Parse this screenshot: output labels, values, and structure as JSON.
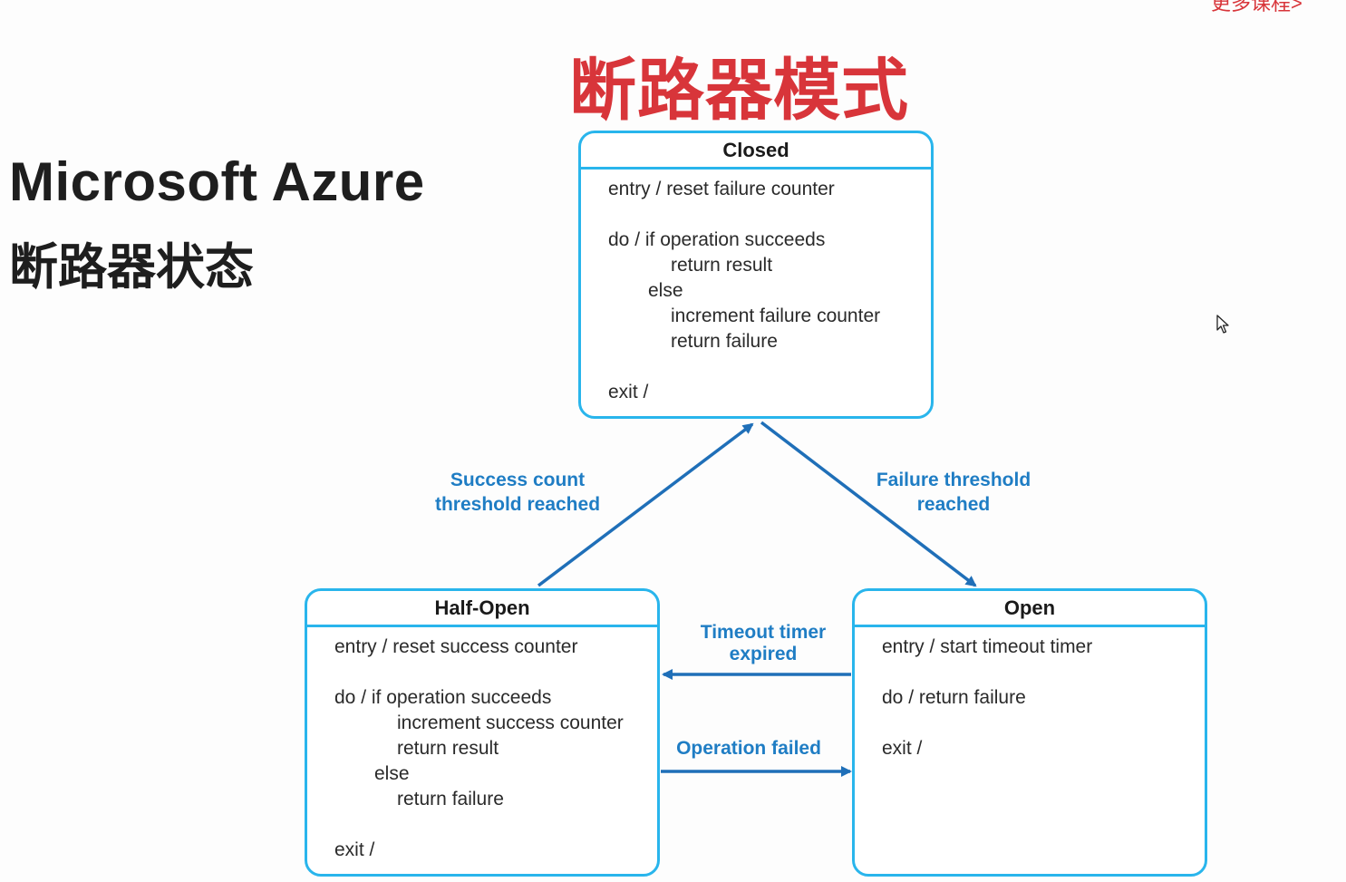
{
  "corner_text": "更多课程>",
  "main_title": "断路器模式",
  "left_title": {
    "line1": "Microsoft Azure",
    "line2": "断路器状态"
  },
  "colors": {
    "title_red": "#d8353a",
    "box_border": "#29b5ec",
    "arrow": "#1f6fb8",
    "label_blue": "#1f7dc4"
  },
  "states": {
    "closed": {
      "name": "Closed",
      "lines": [
        "entry / reset failure counter",
        "do / if operation succeeds",
        "return result",
        "else",
        "increment failure counter",
        "return failure",
        "exit /"
      ]
    },
    "half_open": {
      "name": "Half-Open",
      "lines": [
        "entry / reset success counter",
        "do / if operation succeeds",
        "increment success counter",
        "return result",
        "else",
        "return failure",
        "exit /"
      ]
    },
    "open": {
      "name": "Open",
      "lines": [
        "entry / start timeout timer",
        "do / return failure",
        "exit /"
      ]
    }
  },
  "transitions": {
    "halfopen_to_closed": [
      "Success count",
      "threshold reached"
    ],
    "closed_to_open": [
      "Failure threshold",
      "reached"
    ],
    "open_to_halfopen": [
      "Timeout timer",
      "expired"
    ],
    "halfopen_to_open": [
      "Operation failed"
    ]
  }
}
